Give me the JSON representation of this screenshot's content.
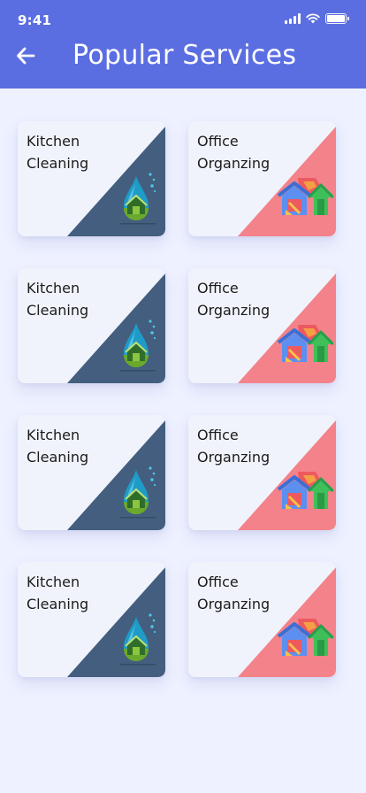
{
  "status_bar": {
    "time": "9:41",
    "icons": [
      "signal-icon",
      "wifi-icon",
      "battery-icon"
    ]
  },
  "header": {
    "title": "Popular Services",
    "back_icon": "arrow-left-icon",
    "background": "#5b6ee1"
  },
  "services": [
    {
      "line1": "Kitchen",
      "line2": "Cleaning",
      "accent": "#435e7e",
      "icon": "house-drop-icon"
    },
    {
      "line1": "Office",
      "line2": "Organzing",
      "accent": "#f3828a",
      "icon": "house-broom-icon"
    },
    {
      "line1": "Kitchen",
      "line2": "Cleaning",
      "accent": "#435e7e",
      "icon": "house-drop-icon"
    },
    {
      "line1": "Office",
      "line2": "Organzing",
      "accent": "#f3828a",
      "icon": "house-broom-icon"
    },
    {
      "line1": "Kitchen",
      "line2": "Cleaning",
      "accent": "#435e7e",
      "icon": "house-drop-icon"
    },
    {
      "line1": "Office",
      "line2": "Organzing",
      "accent": "#f3828a",
      "icon": "house-broom-icon"
    },
    {
      "line1": "Kitchen",
      "line2": "Cleaning",
      "accent": "#435e7e",
      "icon": "house-drop-icon"
    },
    {
      "line1": "Office",
      "line2": "Organzing",
      "accent": "#f3828a",
      "icon": "house-broom-icon"
    }
  ]
}
